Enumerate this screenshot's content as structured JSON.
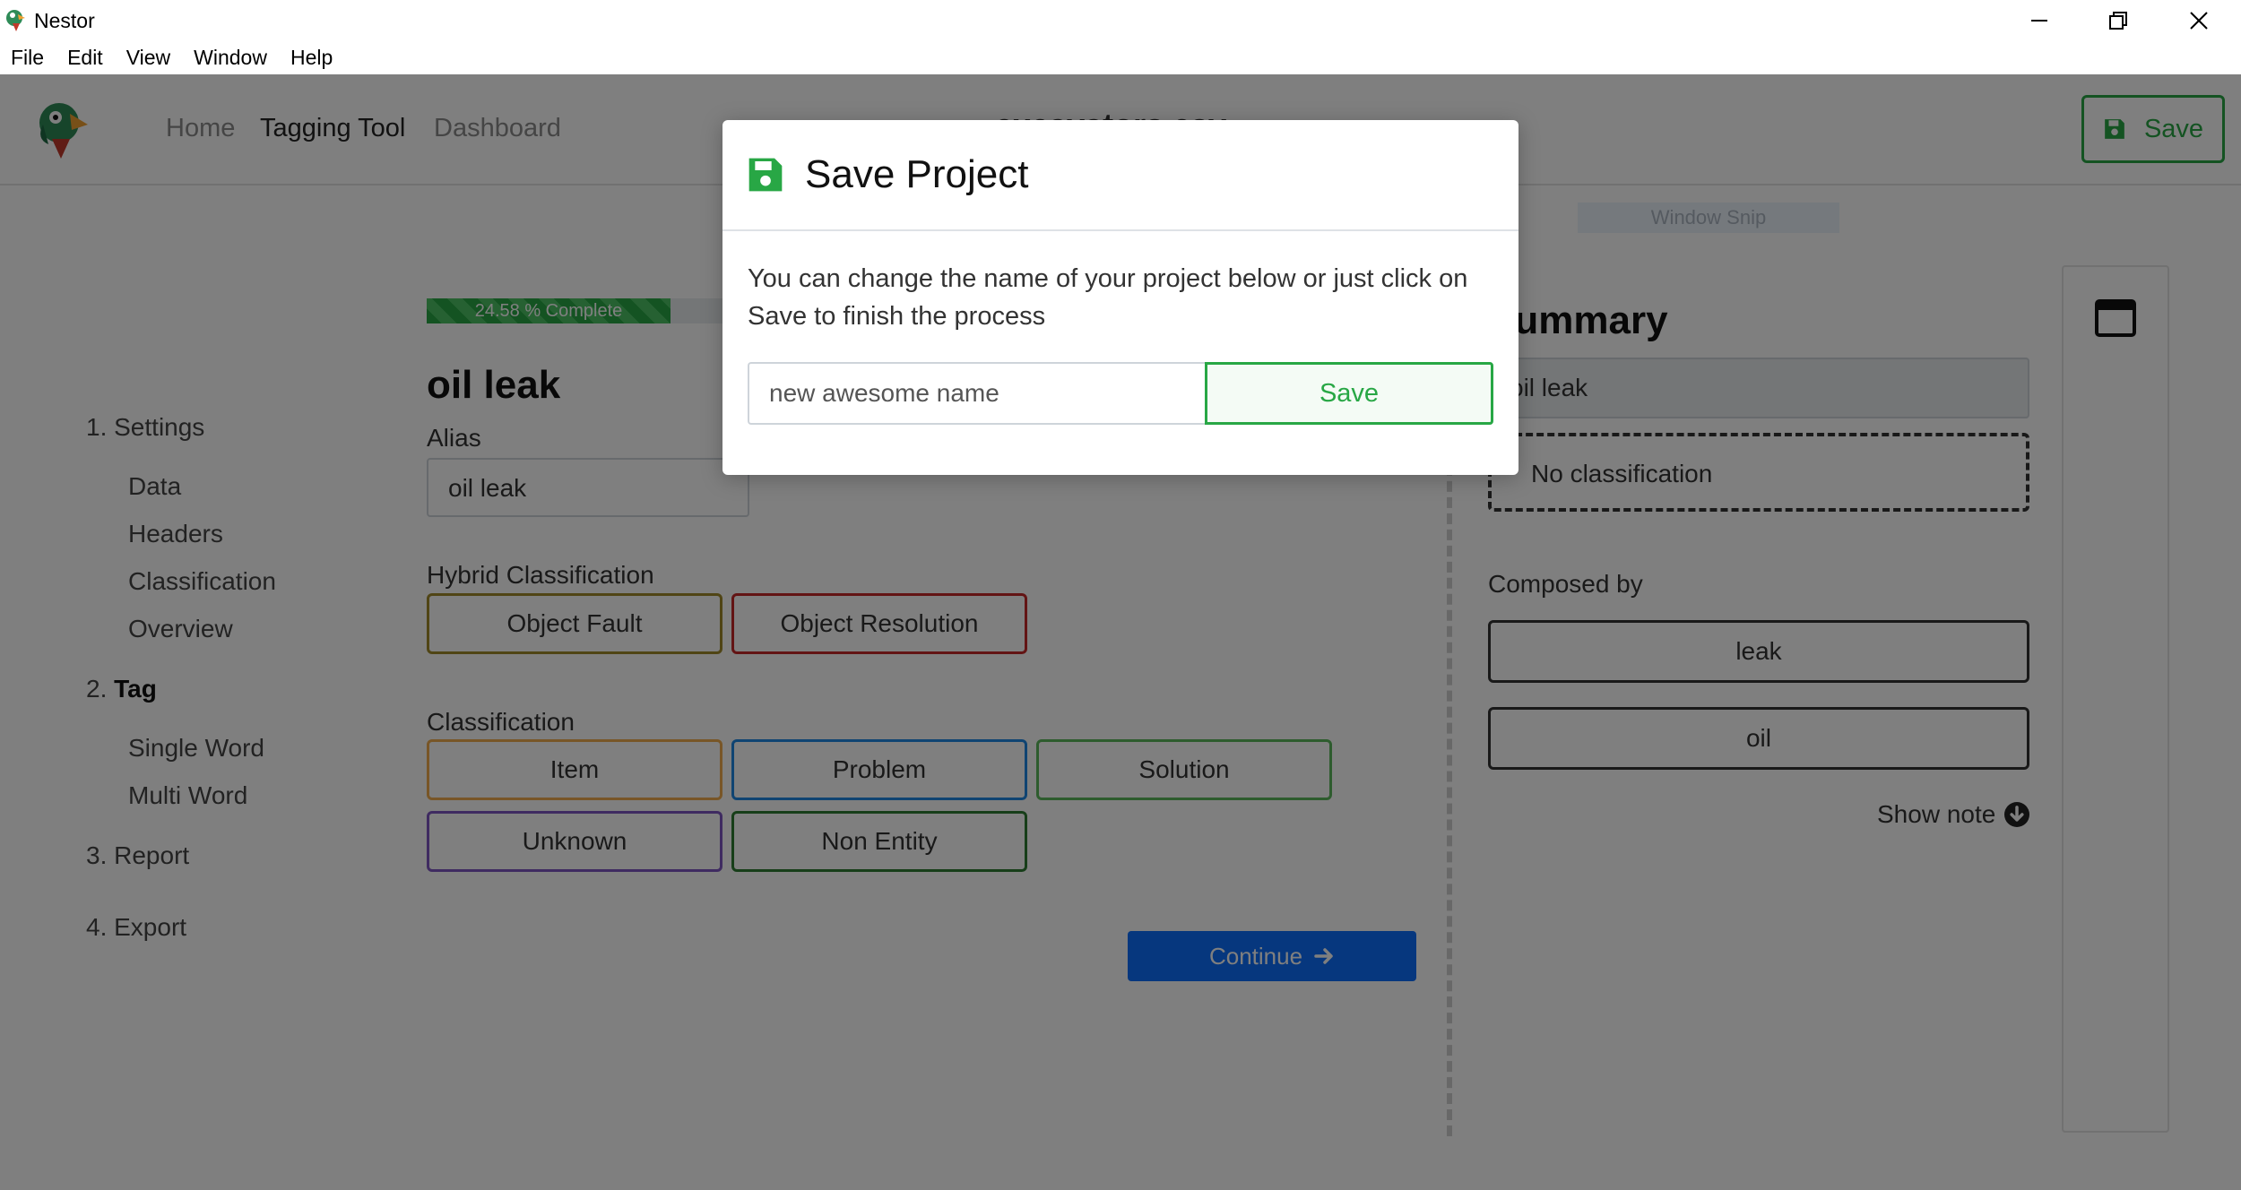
{
  "window": {
    "title": "Nestor"
  },
  "menu": [
    "File",
    "Edit",
    "View",
    "Window",
    "Help"
  ],
  "nav": {
    "links": [
      "Home",
      "Tagging Tool",
      "Dashboard"
    ],
    "filename": "excavators.csv",
    "save_label": "Save"
  },
  "sidebar": {
    "settings": "1. Settings",
    "data": "Data",
    "headers": "Headers",
    "classification": "Classification",
    "overview": "Overview",
    "tag_num": "2.",
    "tag": "Tag",
    "single_word": "Single Word",
    "multi_word": "Multi Word",
    "report": "3. Report",
    "export": "4. Export"
  },
  "main": {
    "progress_text": "24.58 % Complete",
    "progress_value": 24.58,
    "term": "oil leak",
    "alias_label": "Alias",
    "alias_value": "oil leak",
    "hybrid_label": "Hybrid Classification",
    "hybrid": [
      "Object Fault",
      "Object Resolution"
    ],
    "classification_label": "Classification",
    "classes": [
      "Item",
      "Problem",
      "Solution",
      "Unknown",
      "Non Entity"
    ],
    "continue_label": "Continue"
  },
  "summary": {
    "title": "Summary",
    "value": "oil leak",
    "no_class": "No classification",
    "composed_label": "Composed by",
    "composed": [
      "leak",
      "oil"
    ],
    "show_note": "Show note"
  },
  "window_snip": "Window Snip",
  "modal": {
    "title": "Save Project",
    "text": "You can change the name of your project below or just click on Save to finish the process",
    "input_value": "new awesome name",
    "save_label": "Save"
  },
  "colors": {
    "item": "#f0ad4e",
    "problem": "#1e88e5",
    "solution": "#5cb85c",
    "unknown": "#7e57c2",
    "non_entity": "#2e7d32",
    "object_fault": "#a08a2a",
    "object_resolution": "#c62828"
  }
}
